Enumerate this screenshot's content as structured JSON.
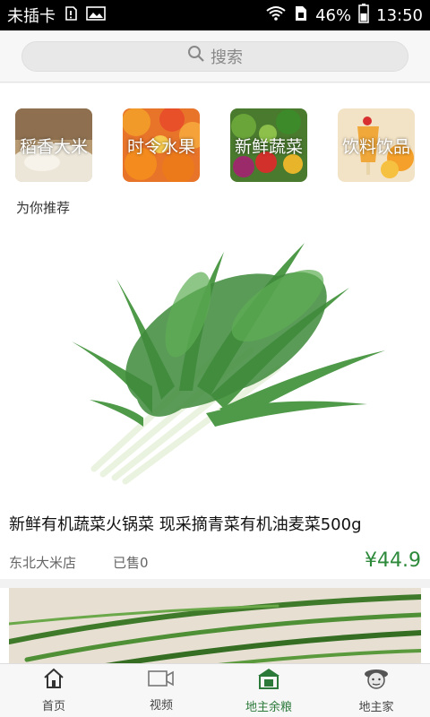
{
  "status_bar": {
    "carrier": "未插卡",
    "battery": "46%",
    "time": "13:50"
  },
  "search": {
    "placeholder": "搜索",
    "icon": "search-icon"
  },
  "categories": [
    {
      "label": "稻香大米",
      "icon": "rice-image"
    },
    {
      "label": "时令水果",
      "icon": "fruit-image"
    },
    {
      "label": "新鲜蔬菜",
      "icon": "vegetable-image"
    },
    {
      "label": "饮料饮品",
      "icon": "drink-image"
    }
  ],
  "recommend": {
    "title": "为你推荐"
  },
  "products": [
    {
      "name": "新鲜有机蔬菜火锅菜 现采摘青菜有机油麦菜500g",
      "shop": "东北大米店",
      "sold": "已售0",
      "price": "¥44.9"
    }
  ],
  "bottom_nav": [
    {
      "label": "首页",
      "icon": "home-icon"
    },
    {
      "label": "视频",
      "icon": "video-icon"
    },
    {
      "label": "地主余粮",
      "icon": "grain-icon"
    },
    {
      "label": "地主家",
      "icon": "farmer-icon"
    }
  ],
  "colors": {
    "accent": "#2c8a3a",
    "status_bar": "#000000"
  }
}
